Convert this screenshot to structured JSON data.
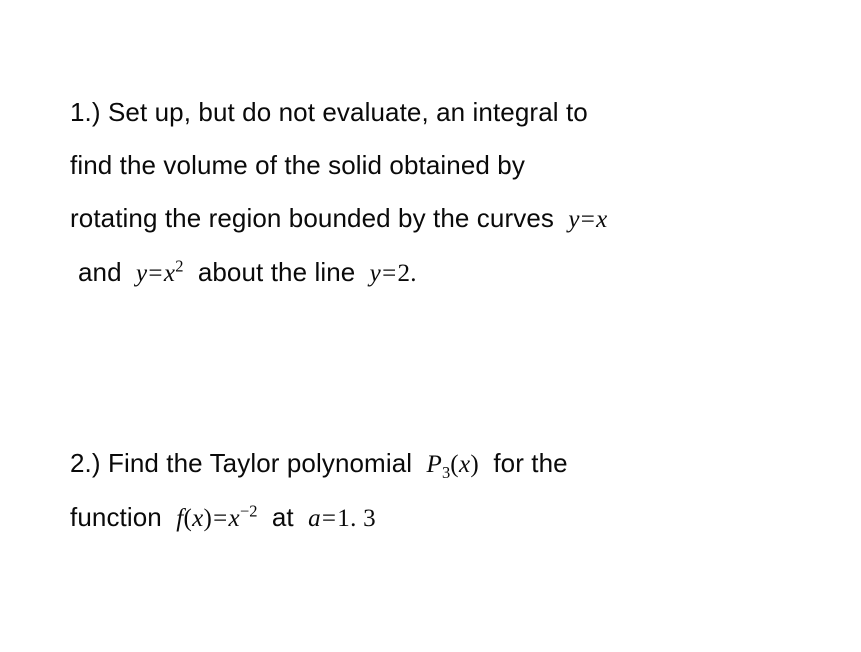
{
  "slide": {
    "background_color": "#ffffff",
    "text_color": "#0a0a0a",
    "problems": [
      {
        "number_label": "1.)",
        "lines": [
          {
            "segments": [
              {
                "kind": "text",
                "value": "1.)  Set up, but do not evaluate, an integral to"
              }
            ]
          },
          {
            "segments": [
              {
                "kind": "text",
                "value": "find the volume of the solid obtained by"
              }
            ]
          },
          {
            "segments": [
              {
                "kind": "text",
                "value": "rotating the region bounded by the curves"
              },
              {
                "kind": "math",
                "value": "y = x"
              }
            ]
          },
          {
            "segments": [
              {
                "kind": "text",
                "value": "and"
              },
              {
                "kind": "math",
                "value": "y = x2"
              },
              {
                "kind": "text",
                "value": "about the line"
              },
              {
                "kind": "math",
                "value": "y = 2."
              }
            ]
          }
        ]
      },
      {
        "number_label": "2.)",
        "lines": [
          {
            "segments": [
              {
                "kind": "text",
                "value": "2.)  Find the Taylor polynomial"
              },
              {
                "kind": "math",
                "value": "P3(x)"
              },
              {
                "kind": "text",
                "value": "for the"
              }
            ]
          },
          {
            "segments": [
              {
                "kind": "text",
                "value": "function"
              },
              {
                "kind": "math",
                "value": "f (x)= x-2"
              },
              {
                "kind": "text",
                "value": "at"
              },
              {
                "kind": "math",
                "value": "a =1. 3"
              }
            ]
          }
        ]
      }
    ],
    "text": {
      "p1_line1": "1.)  Set up, but do not evaluate, an integral to",
      "p1_line2": "find the volume of the solid obtained by",
      "p1_line3_prefix": "rotating the region bounded by the curves",
      "p1_line3_math_y": "y",
      "p1_line3_math_eq": "=",
      "p1_line3_math_x": "x",
      "p1_line4_prefix": "and",
      "p1_line4_math_y": "y",
      "p1_line4_math_eq": "=",
      "p1_line4_math_x": "x",
      "p1_line4_math_exp": "2",
      "p1_line4_mid": "about the line",
      "p1_line4_math_y2": "y",
      "p1_line4_math_eq2": "=",
      "p1_line4_math_val": "2.",
      "p2_line1_prefix": "2.)  Find the Taylor polynomial",
      "p2_line1_math_P": "P",
      "p2_line1_math_sub": "3",
      "p2_line1_math_paren_open": "(",
      "p2_line1_math_x": "x",
      "p2_line1_math_paren_close": ")",
      "p2_line1_suffix": "for the",
      "p2_line2_prefix": "function",
      "p2_line2_math_f": "f",
      "p2_line2_math_paren_open": "(",
      "p2_line2_math_x": "x",
      "p2_line2_math_paren_close": ")",
      "p2_line2_math_eq": "=",
      "p2_line2_math_x2": "x",
      "p2_line2_math_exp": "−2",
      "p2_line2_mid": "at",
      "p2_line2_math_a": "a",
      "p2_line2_math_eq2": "=",
      "p2_line2_math_val": "1. 3"
    }
  }
}
